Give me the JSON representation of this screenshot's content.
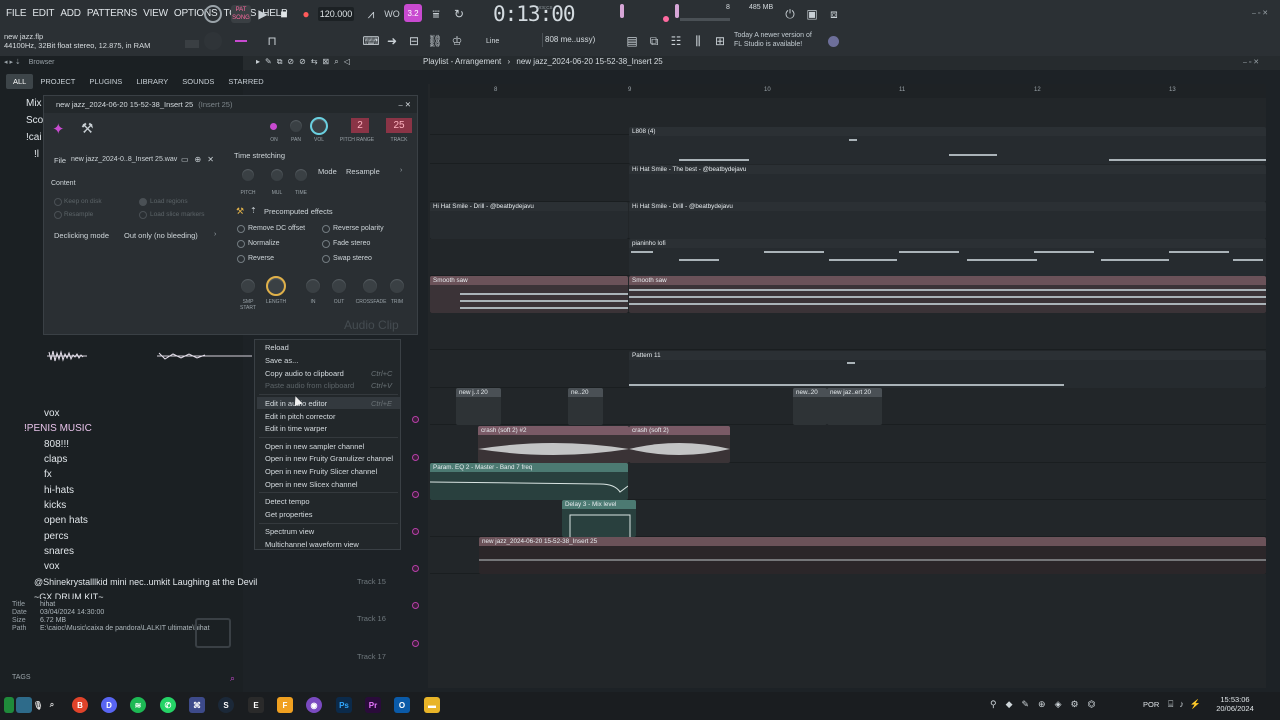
{
  "menu": [
    "FILE",
    "EDIT",
    "ADD",
    "PATTERNS",
    "VIEW",
    "OPTIONS",
    "TOOLS",
    "HELP"
  ],
  "project": {
    "name": "new jazz.flp",
    "info": "44100Hz, 32Bit float stereo, 12.875, in RAM"
  },
  "transport": {
    "mode": "SONG",
    "pat": "PAT",
    "tempo": "120.000",
    "time": "0:13:00",
    "time_label": "M:S:CS",
    "memory": "485 MB",
    "cpu": "8"
  },
  "toolbar2": {
    "snap": "Line",
    "preset": "808 me..ussy)"
  },
  "news": {
    "line1": "Today  A newer version of",
    "line2": "FL Studio is available!"
  },
  "browser": {
    "tabs": [
      "ALL",
      "PROJECT",
      "PLUGINS",
      "LIBRARY",
      "SOUNDS",
      "STARRED"
    ],
    "title": "Browser",
    "items": [
      "Mix",
      "Sco",
      "!cai",
      "!l",
      "vox",
      "!PENIS MUSIC",
      "808!!!",
      "claps",
      "fx",
      "hi-hats",
      "kicks",
      "open hats",
      "percs",
      "snares",
      "vox",
      "@Shinekrystalllkid mini nec..umkit Laughing at the Devil",
      "~GX DRUM KIT~"
    ],
    "meta": {
      "title_k": "Title",
      "title_v": "hihat",
      "date_k": "Date",
      "date_v": "03/04/2024 14:30:00",
      "size_k": "Size",
      "size_v": "6.72 MB",
      "path_k": "Path",
      "path_v": "E:\\caioc\\Music\\caixa de pandora\\LALKIT ultimate\\hihat"
    },
    "tags": "TAGS"
  },
  "clipwin": {
    "title": "new jazz_2024-06-20 15-52-38_Insert 25",
    "title_suffix": "(Insert 25)",
    "on": "ON",
    "pan": "PAN",
    "vol": "VOL",
    "pitch_range": "PITCH RANGE",
    "track": "TRACK",
    "pitch_range_val": "2",
    "track_val": "25",
    "file_label": "File",
    "file_name": "new jazz_2024-0..8_Insert 25.wav",
    "content": "Content",
    "keep_on_disk": "Keep on disk",
    "resample": "Resample",
    "load_regions": "Load regions",
    "load_slice": "Load slice markers",
    "declicking": "Declicking mode",
    "declick_val": "Out only (no bleeding)",
    "time_stretching": "Time stretching",
    "pitch": "PITCH",
    "mul": "MUL",
    "time": "TIME",
    "mode_label": "Mode",
    "mode_val": "Resample",
    "precomputed": "Precomputed effects",
    "effects": [
      "Remove DC offset",
      "Reverse polarity",
      "Normalize",
      "Fade stereo",
      "Reverse",
      "Swap stereo"
    ],
    "knobs": [
      "SMP START",
      "LENGTH",
      "IN",
      "OUT",
      "CROSSFADE",
      "TRIM"
    ],
    "watermark": "Audio Clip"
  },
  "ctx": {
    "items": [
      {
        "t": "Reload",
        "s": ""
      },
      {
        "t": "Save as...",
        "s": ""
      },
      {
        "t": "Copy audio to clipboard",
        "s": "Ctrl+C"
      },
      {
        "t": "Paste audio from clipboard",
        "s": "Ctrl+V",
        "d": true
      },
      {
        "t": "Edit in audio editor",
        "s": "Ctrl+E",
        "h": true
      },
      {
        "t": "Edit in pitch corrector",
        "s": ""
      },
      {
        "t": "Edit in time warper",
        "s": ""
      },
      {
        "t": "Open in new sampler channel",
        "s": ""
      },
      {
        "t": "Open in new Fruity Granulizer channel",
        "s": ""
      },
      {
        "t": "Open in new Fruity Slicer channel",
        "s": ""
      },
      {
        "t": "Open in new Slicex channel",
        "s": ""
      },
      {
        "t": "Detect tempo",
        "s": ""
      },
      {
        "t": "Get properties",
        "s": ""
      },
      {
        "t": "Spectrum view",
        "s": ""
      },
      {
        "t": "Multichannel waveform view",
        "s": ""
      }
    ]
  },
  "playlist": {
    "title": "Playlist - Arrangement",
    "pattern": "new jazz_2024-06-20 15-52-38_Insert 25",
    "bars": [
      "8",
      "9",
      "10",
      "11",
      "12",
      "13"
    ],
    "clips": [
      {
        "t": "L808 (4)"
      },
      {
        "t": "Hi Hat Smile - The best - @beatbydejavu"
      },
      {
        "t": "Hi Hat Smile - Drill - @beatbydejavu"
      },
      {
        "t": "Hi Hat Smile - Drill - @beatbydejavu"
      },
      {
        "t": "pianinho lofi"
      },
      {
        "t": "Smooth saw"
      },
      {
        "t": "Smooth saw"
      },
      {
        "t": "Pattern 11"
      },
      {
        "t": "new j..t 20"
      },
      {
        "t": "ne..20"
      },
      {
        "t": "new..20"
      },
      {
        "t": "new jaz..ert 20"
      },
      {
        "t": "crash (soft 2) #2"
      },
      {
        "t": "crash (soft 2)"
      },
      {
        "t": "Param. EQ 2 - Master - Band 7 freq"
      },
      {
        "t": "Delay 3 - Mix level"
      },
      {
        "t": "new jazz_2024-06-20 15-52-38_Insert 25"
      }
    ],
    "tracks": [
      "Track 15",
      "Track 16",
      "Track 17"
    ]
  },
  "taskbar": {
    "lang": "POR",
    "time": "15:53:06",
    "date": "20/06/2024"
  }
}
